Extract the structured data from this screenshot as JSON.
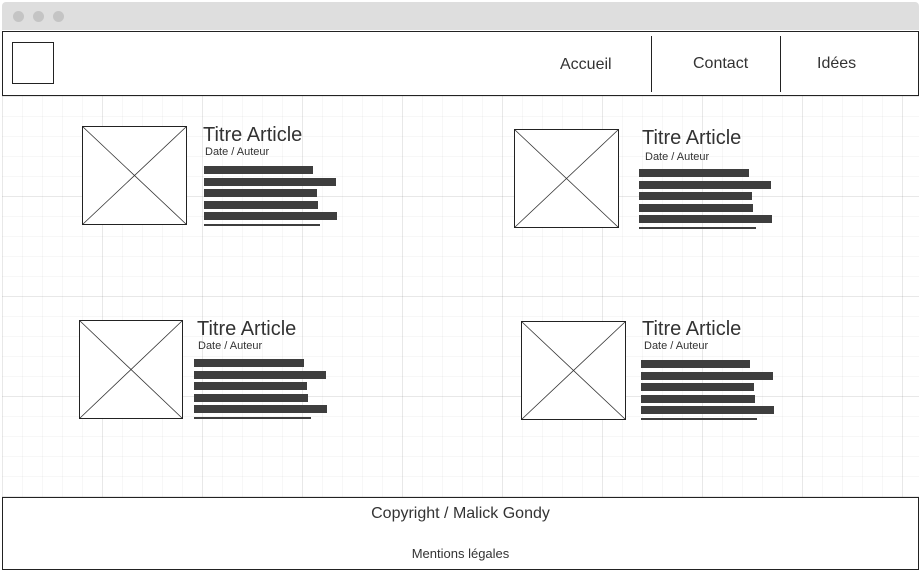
{
  "header": {
    "logo": "logo-placeholder",
    "nav": [
      {
        "label": "Accueil"
      },
      {
        "label": "Contact"
      },
      {
        "label": "Idées"
      }
    ]
  },
  "articles": [
    {
      "title": "Titre Article",
      "meta": "Date / Auteur",
      "image": "image-placeholder-icon"
    },
    {
      "title": "Titre Article",
      "meta": "Date / Auteur",
      "image": "image-placeholder-icon"
    },
    {
      "title": "Titre Article",
      "meta": "Date / Auteur",
      "image": "image-placeholder-icon"
    },
    {
      "title": "Titre Article",
      "meta": "Date / Auteur",
      "image": "image-placeholder-icon"
    }
  ],
  "footer": {
    "copyright": "Copyright / Malick Gondy",
    "legal": "Mentions légales"
  },
  "colors": {
    "titlebar": "#dedede",
    "text_bars": "#3e3e3e",
    "border": "#222222"
  }
}
